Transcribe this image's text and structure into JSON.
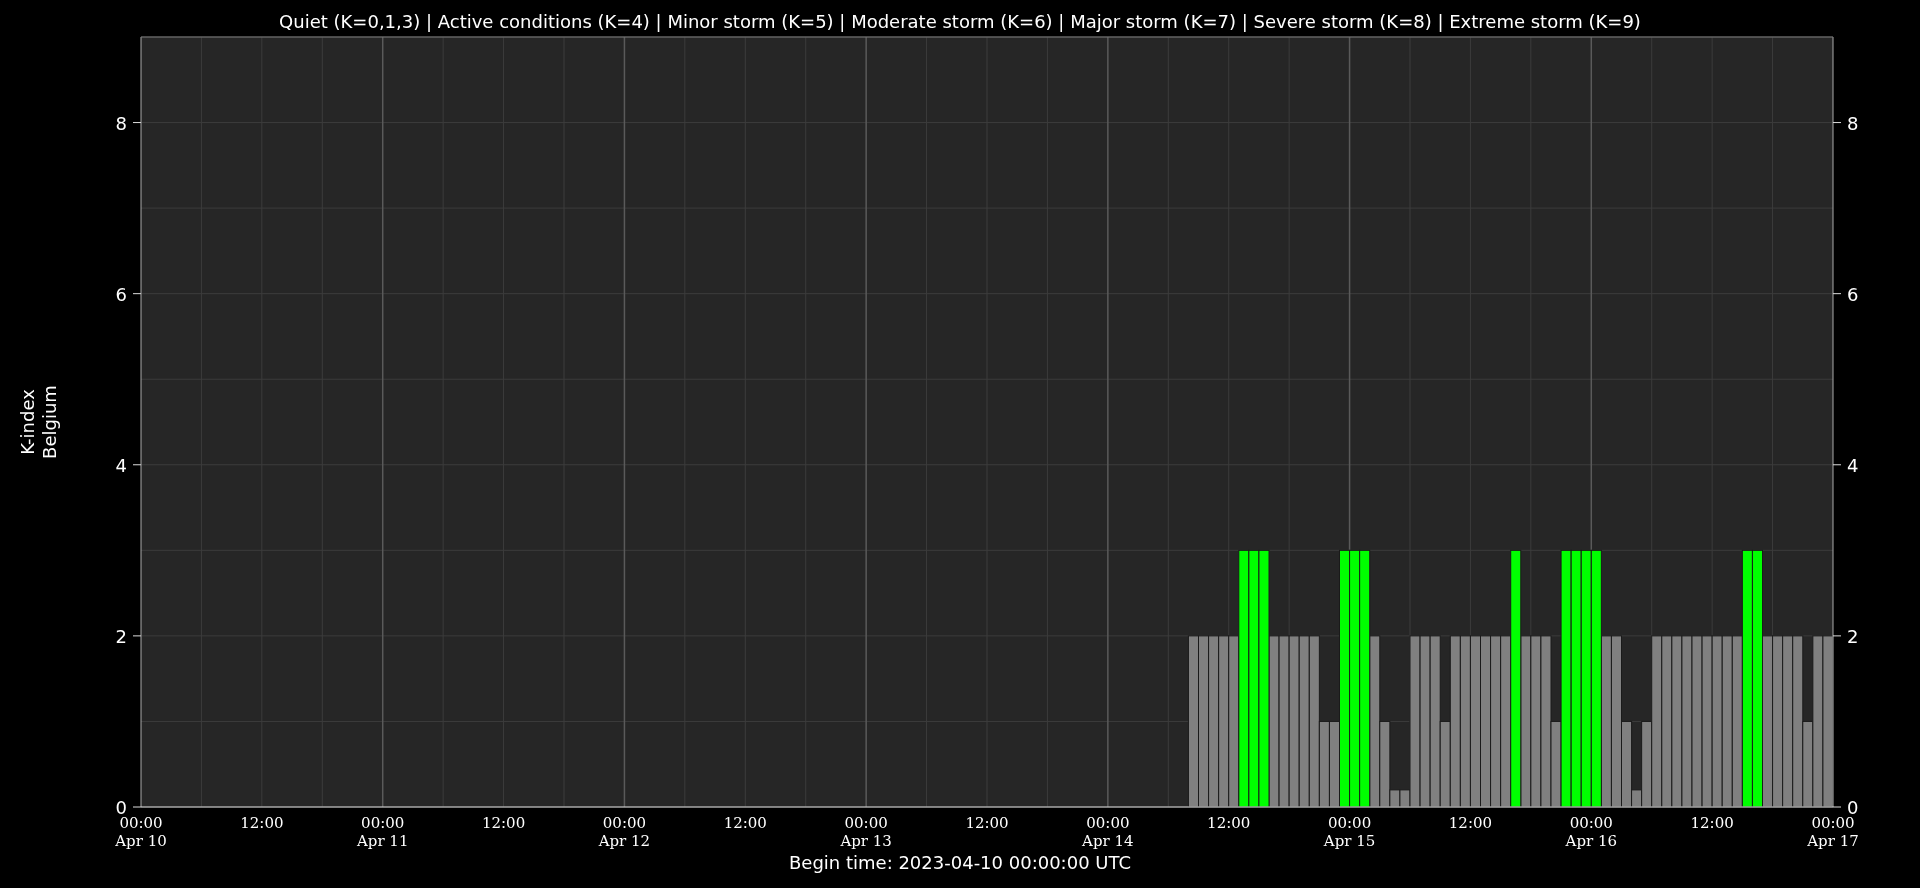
{
  "chart_data": {
    "type": "bar",
    "stacked": true,
    "title": "Quiet (K=0,1,3) | Active conditions (K=4) | Minor storm (K=5) | Moderate storm (K=6) | Major storm (K=7) | Severe storm (K=8) | Extreme storm (K=9)",
    "xlabel": "Begin time: 2023-04-10 00:00:00 UTC",
    "ylabel": "K-index\nBelgium",
    "ylim": [
      0,
      9
    ],
    "categories": [
      "00:00\nApr 10",
      null,
      null,
      null,
      null,
      null,
      null,
      null,
      null,
      null,
      null,
      null,
      "12:00",
      null,
      null,
      null,
      null,
      null,
      null,
      null,
      null,
      null,
      null,
      null,
      "00:00\nApr 11",
      null,
      null,
      null,
      null,
      null,
      null,
      null,
      null,
      null,
      null,
      null,
      "12:00",
      null,
      null,
      null,
      null,
      null,
      null,
      null,
      null,
      null,
      null,
      null,
      "00:00\nApr 12",
      null,
      null,
      null,
      null,
      null,
      null,
      null,
      null,
      null,
      null,
      null,
      "12:00",
      null,
      null,
      null,
      null,
      null,
      null,
      null,
      null,
      null,
      null,
      null,
      "00:00\nApr 13",
      null,
      null,
      null,
      null,
      null,
      null,
      null,
      null,
      null,
      null,
      null,
      "12:00",
      null,
      null,
      null,
      null,
      null,
      null,
      null,
      null,
      null,
      null,
      null,
      "00:00\nApr 14",
      null,
      null,
      null,
      null,
      null,
      null,
      null,
      null,
      null,
      null,
      null,
      "12:00",
      null,
      null,
      null,
      null,
      null,
      null,
      null,
      null,
      null,
      null,
      null,
      "00:00\nApr 15",
      null,
      null,
      null,
      null,
      null,
      null,
      null,
      null,
      null,
      null,
      null,
      "12:00",
      null,
      null,
      null,
      null,
      null,
      null,
      null,
      null,
      null,
      null,
      null,
      "00:00\nApr 16",
      null,
      null,
      null,
      null,
      null,
      null,
      null,
      null,
      null,
      null,
      null,
      "12:00",
      null,
      null,
      null,
      null,
      null,
      null,
      null,
      null,
      null,
      null,
      null,
      "00:00\nApr 17"
    ],
    "series": [
      {
        "color": "#808080",
        "values": [
          null,
          null,
          null,
          null,
          null,
          null,
          null,
          null,
          null,
          null,
          null,
          null,
          null,
          null,
          null,
          null,
          null,
          null,
          null,
          null,
          null,
          null,
          null,
          null,
          null,
          null,
          null,
          null,
          null,
          null,
          null,
          null,
          null,
          null,
          null,
          null,
          null,
          null,
          null,
          null,
          null,
          null,
          null,
          null,
          null,
          null,
          null,
          null,
          null,
          null,
          null,
          null,
          null,
          null,
          null,
          null,
          null,
          null,
          null,
          null,
          null,
          null,
          null,
          null,
          null,
          null,
          null,
          null,
          null,
          null,
          null,
          null,
          null,
          null,
          null,
          null,
          null,
          null,
          null,
          null,
          null,
          null,
          null,
          null,
          null,
          null,
          null,
          null,
          null,
          null,
          null,
          null,
          null,
          null,
          null,
          null,
          null,
          null,
          null,
          null,
          null,
          null,
          null,
          null,
          2,
          2,
          2,
          2,
          2,
          null,
          null,
          null,
          2,
          2,
          2,
          2,
          2,
          1,
          1,
          null,
          null,
          null,
          2,
          1,
          0.2,
          0.2,
          2,
          2,
          2,
          1,
          2,
          2,
          2,
          2,
          2,
          2,
          null,
          2,
          2,
          2,
          1,
          null,
          null,
          null,
          null,
          2,
          2,
          1,
          0.2,
          1,
          2,
          2,
          2,
          2,
          2,
          2,
          2,
          2,
          2,
          null,
          null,
          2,
          2,
          2,
          2,
          1,
          2,
          2,
          null
        ]
      },
      {
        "color": "#00ff00",
        "values": [
          null,
          null,
          null,
          null,
          null,
          null,
          null,
          null,
          null,
          null,
          null,
          null,
          null,
          null,
          null,
          null,
          null,
          null,
          null,
          null,
          null,
          null,
          null,
          null,
          null,
          null,
          null,
          null,
          null,
          null,
          null,
          null,
          null,
          null,
          null,
          null,
          null,
          null,
          null,
          null,
          null,
          null,
          null,
          null,
          null,
          null,
          null,
          null,
          null,
          null,
          null,
          null,
          null,
          null,
          null,
          null,
          null,
          null,
          null,
          null,
          null,
          null,
          null,
          null,
          null,
          null,
          null,
          null,
          null,
          null,
          null,
          null,
          null,
          null,
          null,
          null,
          null,
          null,
          null,
          null,
          null,
          null,
          null,
          null,
          null,
          null,
          null,
          null,
          null,
          null,
          null,
          null,
          null,
          null,
          null,
          null,
          null,
          null,
          null,
          null,
          null,
          null,
          null,
          null,
          null,
          null,
          null,
          null,
          null,
          3,
          3,
          3,
          null,
          null,
          null,
          null,
          null,
          null,
          null,
          3,
          3,
          3,
          null,
          null,
          null,
          null,
          null,
          null,
          null,
          null,
          null,
          null,
          null,
          null,
          null,
          null,
          3,
          null,
          null,
          null,
          null,
          3,
          3,
          3,
          3,
          null,
          null,
          null,
          null,
          null,
          null,
          null,
          null,
          null,
          null,
          null,
          null,
          null,
          null,
          3,
          3,
          null,
          null,
          null,
          null,
          null,
          null,
          null,
          null
        ]
      }
    ],
    "yticks": [
      0,
      2,
      4,
      6,
      8
    ],
    "grid": true,
    "annotations": [
      "0",
      "2",
      "4",
      "6",
      "8"
    ]
  }
}
